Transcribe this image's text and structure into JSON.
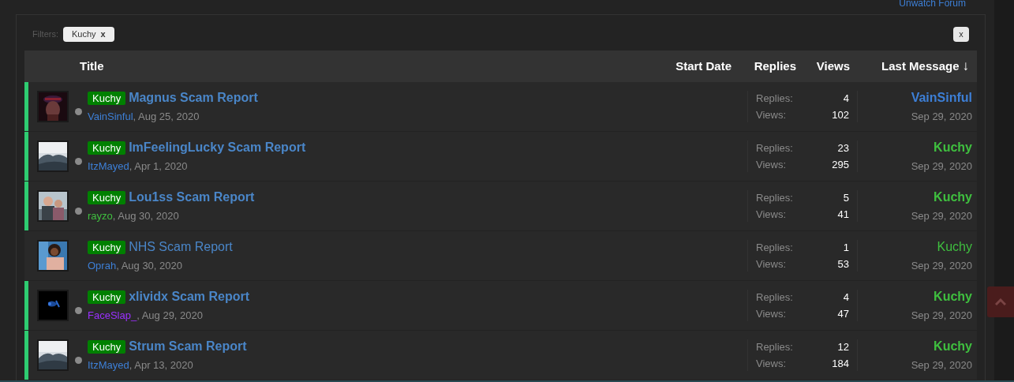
{
  "top_link": "Unwatch Forum",
  "filters": {
    "label": "Filters:",
    "chips": [
      {
        "label": "Kuchy",
        "remove": "x"
      }
    ],
    "clear": "x"
  },
  "columns": [
    {
      "label": "Title"
    },
    {
      "label": "Start Date"
    },
    {
      "label": "Replies"
    },
    {
      "label": "Views"
    },
    {
      "label": "Last Message",
      "sort": "↓"
    }
  ],
  "rows": [
    {
      "unread": true,
      "prefix": "Kuchy",
      "title": "Magnus Scam Report",
      "author": {
        "name": "VainSinful",
        "color": "#3d7fd6"
      },
      "date": ", Aug 25, 2020",
      "replies_label": "Replies:",
      "replies": "4",
      "views_label": "Views:",
      "views": "102",
      "last": {
        "name": "VainSinful",
        "color": "#3d7fd6"
      },
      "last_date": "Sep 29, 2020"
    },
    {
      "unread": true,
      "prefix": "Kuchy",
      "title": "ImFeelingLucky Scam Report",
      "author": {
        "name": "ItzMayed",
        "color": "#3d7fd6"
      },
      "date": ", Apr 1, 2020",
      "replies_label": "Replies:",
      "replies": "23",
      "views_label": "Views:",
      "views": "295",
      "last": {
        "name": "Kuchy",
        "color": "#3fbf3f"
      },
      "last_date": "Sep 29, 2020"
    },
    {
      "unread": true,
      "prefix": "Kuchy",
      "title": "Lou1ss Scam Report",
      "author": {
        "name": "rayzo",
        "color": "#3fbf3f"
      },
      "date": ", Aug 30, 2020",
      "replies_label": "Replies:",
      "replies": "5",
      "views_label": "Views:",
      "views": "41",
      "last": {
        "name": "Kuchy",
        "color": "#3fbf3f"
      },
      "last_date": "Sep 29, 2020"
    },
    {
      "unread": false,
      "prefix": "Kuchy",
      "title": "NHS Scam Report",
      "author": {
        "name": "Oprah",
        "color": "#3d7fd6"
      },
      "date": ", Aug 30, 2020",
      "replies_label": "Replies:",
      "replies": "1",
      "views_label": "Views:",
      "views": "53",
      "last": {
        "name": "Kuchy",
        "color": "#3fbf3f"
      },
      "last_date": "Sep 29, 2020"
    },
    {
      "unread": true,
      "prefix": "Kuchy",
      "title": "xlividx Scam Report",
      "author": {
        "name": "FaceSlap_",
        "color": "#9b30ff"
      },
      "date": ", Aug 29, 2020",
      "replies_label": "Replies:",
      "replies": "4",
      "views_label": "Views:",
      "views": "47",
      "last": {
        "name": "Kuchy",
        "color": "#3fbf3f"
      },
      "last_date": "Sep 29, 2020"
    },
    {
      "unread": true,
      "prefix": "Kuchy",
      "title": "Strum Scam Report",
      "author": {
        "name": "ItzMayed",
        "color": "#3d7fd6"
      },
      "date": ", Apr 13, 2020",
      "replies_label": "Replies:",
      "replies": "12",
      "views_label": "Views:",
      "views": "184",
      "last": {
        "name": "Kuchy",
        "color": "#3fbf3f"
      },
      "last_date": "Sep 29, 2020"
    }
  ]
}
